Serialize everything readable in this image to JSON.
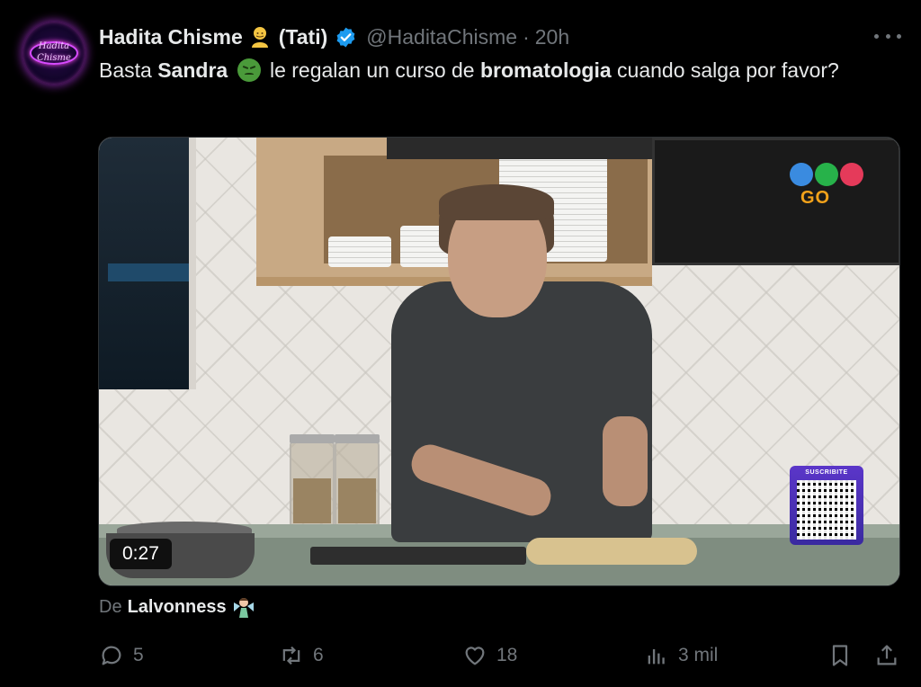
{
  "post": {
    "avatar_text_line1": "Hadita",
    "avatar_text_line2": "Chisme",
    "author_name": "Hadita Chisme",
    "author_nick": "(Tati)",
    "handle": "@HaditaChisme",
    "separator": "·",
    "time": "20h",
    "text_part1": "Basta ",
    "text_bold1": "Sandra",
    "text_part2": " le regalan un curso de ",
    "text_bold2": "bromatologia",
    "text_part3": " cuando salga por favor?",
    "media": {
      "duration": "0:27",
      "channel_logo_text": "GO",
      "qr_label": "SUSCRIBITE"
    },
    "attribution": {
      "prefix": "De",
      "user": "Lalvonness"
    },
    "stats": {
      "replies": "5",
      "reposts": "6",
      "likes": "18",
      "views": "3 mil"
    }
  },
  "colors": {
    "background": "#000000",
    "text_primary": "#e7e9ea",
    "text_secondary": "#71767b",
    "verified_blue": "#1d9bf0"
  }
}
